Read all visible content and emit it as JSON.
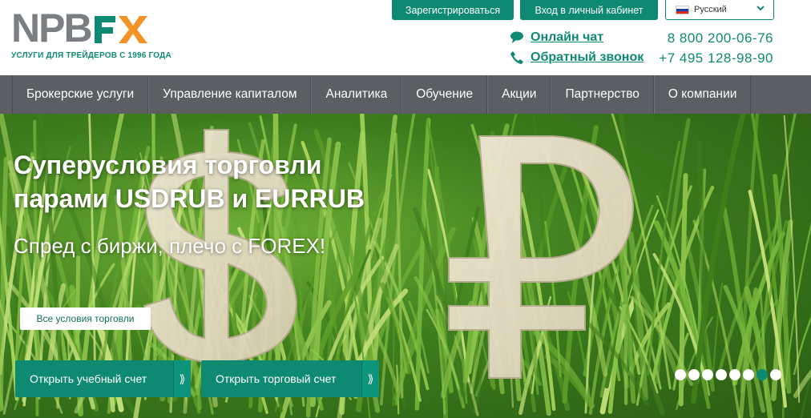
{
  "logo": {
    "text": "NPBFX",
    "tagline": "УСЛУГИ ДЛЯ ТРЕЙДЕРОВ С 1996 ГОДА"
  },
  "header": {
    "register_label": "Зарегистрироваться",
    "login_label": "Вход в личный кабинет",
    "language": "Русский",
    "online_chat": "Онлайн чат",
    "callback": "Обратный звонок",
    "phone1": "8 800 200-06-76",
    "phone2": "+7 495 128-98-90"
  },
  "nav": {
    "items": [
      {
        "label": "Брокерские услуги"
      },
      {
        "label": "Управление капиталом"
      },
      {
        "label": "Аналитика"
      },
      {
        "label": "Обучение"
      },
      {
        "label": "Акции"
      },
      {
        "label": "Партнерство"
      },
      {
        "label": "О компании"
      }
    ]
  },
  "hero": {
    "headline_line1": "Суперусловия торговли",
    "headline_line2": "парами USDRUB и EURRUB",
    "subline": "Спред с биржи, плечо с FOREX!",
    "terms_button": "Все условия торговли",
    "demo_button": "Открыть учебный счет",
    "real_button": "Открыть торговый счет",
    "arrow_glyph": "⟫",
    "slides_total": 8,
    "active_slide": 7
  },
  "colors": {
    "brand_green": "#0e8a73",
    "logo_gray": "#7b7e83",
    "logo_orange": "#f39325",
    "nav_bg": "#5b5e62"
  }
}
